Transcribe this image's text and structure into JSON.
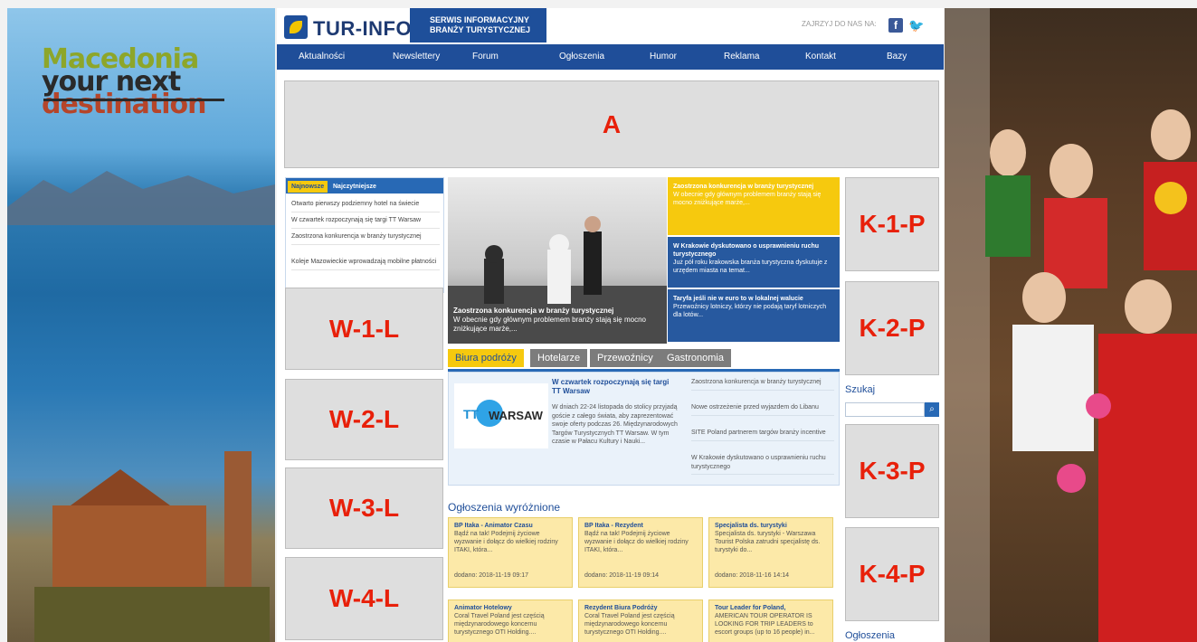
{
  "macedonia": {
    "line1": "Macedonia",
    "line2": "your next",
    "line3": "destination"
  },
  "header": {
    "logo_text": "TUR-INFO.PL",
    "service_line1": "SERWIS INFORMACYJNY",
    "service_line2": "BRANŻY TURYSTYCZNEJ",
    "follow_label": "ZAJRZYJ DO NAS NA:",
    "facebook_icon": "facebook-icon",
    "twitter_icon": "twitter-icon"
  },
  "nav": [
    "Aktualności",
    "Newslettery",
    "Forum",
    "Ogłoszenia",
    "Humor",
    "Reklama",
    "Kontakt",
    "Bazy"
  ],
  "ads": {
    "a": "A",
    "w1": "W-1-L",
    "w2": "W-2-L",
    "w3": "W-3-L",
    "w4": "W-4-L",
    "k1": "K-1-P",
    "k2": "K-2-P",
    "k3": "K-3-P",
    "k4": "K-4-P"
  },
  "latest": {
    "tab_newest": "Najnowsze",
    "tab_popular": "Najczytniejsze",
    "items": [
      "Otwarto pierwszy podziemny hotel na świecie",
      "W czwartek rozpoczynają się targi TT Warsaw",
      "Zaostrzona konkurencja w branży turystycznej",
      "Koleje Mazowieckie wprowadzają mobilne płatności"
    ]
  },
  "featured": {
    "main_title": "Zaostrzona konkurencja w branży turystycznej",
    "main_text": "W obecnie gdy głównym problemem branży stają się mocno zniżkujące marże,...",
    "card1_title": "Zaostrzona konkurencja w branży turystycznej",
    "card1_text": "W obecnie gdy głównym problemem branży stają się mocno zniżkujące marże,...",
    "card2_title": "W Krakowie dyskutowano o usprawnieniu ruchu turystycznego",
    "card2_text": "Już pół roku krakowska branża turystyczna dyskutuje z urzędem miasta na temat...",
    "card3_title": "Taryfa jeśli nie w euro to w lokalnej walucie",
    "card3_text": "Przewoźnicy lotniczy, którzy nie podają taryf lotniczych dla lotów..."
  },
  "categories": {
    "tabs": [
      "Biura podróży",
      "Hotelarze",
      "Przewoźnicy",
      "Gastronomia"
    ],
    "logo_tt": "TT",
    "logo_warsaw": "WARSAW",
    "main_title": "W czwartek rozpoczynają się targi TT Warsaw",
    "main_text": "W dniach 22-24 listopada do stolicy przyjadą goście z całego świata, aby zaprezentować swoje oferty podczas 26. Międzynarodowych Targów Turystycznych TT Warsaw. W tym czasie w Pałacu Kultury i Nauki...",
    "side_items": [
      "Zaostrzona konkurencja w branży turystycznej",
      "Nowe ostrzeżenie przed wyjazdem do Libanu",
      "SITE Poland partnerem targów branży incentive",
      "W Krakowie dyskutowano o usprawnieniu ruchu turystycznego"
    ]
  },
  "featured_ads": {
    "title": "Ogłoszenia wyróżnione",
    "jobs": [
      {
        "title": "BP Itaka - Animator Czasu",
        "text": "Bądź na tak! Podejmij życiowe wyzwanie i dołącz do wielkiej rodziny ITAKI, która...",
        "date": "dodano: 2018-11-19 09:17"
      },
      {
        "title": "BP Itaka - Rezydent",
        "text": "Bądź na tak! Podejmij życiowe wyzwanie i dołącz do wielkiej rodziny ITAKI, która...",
        "date": "dodano: 2018-11-19 09:14"
      },
      {
        "title": "Specjalista ds. turystyki",
        "text": "Specjalista ds. turystyki - Warszawa Tourist Polska zatrudni specjalistę ds. turystyki do...",
        "date": "dodano: 2018-11-16 14:14"
      }
    ],
    "jobs2": [
      {
        "title": "Animator Hotelowy",
        "text": "Coral Travel Poland jest częścią międzynarodowego koncernu turystycznego OTI Holding...."
      },
      {
        "title": "Rezydent Biura Podróży",
        "text": "Coral Travel Poland jest częścią międzynarodowego koncernu turystycznego OTI Holding...."
      },
      {
        "title": "Tour Leader for Poland,",
        "text": "AMERICAN TOUR OPERATOR IS LOOKING FOR TRIP LEADERS to escort groups (up to 16 people) in..."
      }
    ]
  },
  "search": {
    "label": "Szukaj",
    "placeholder": "",
    "button_icon": "search-icon"
  },
  "ads_label": "Ogłoszenia"
}
